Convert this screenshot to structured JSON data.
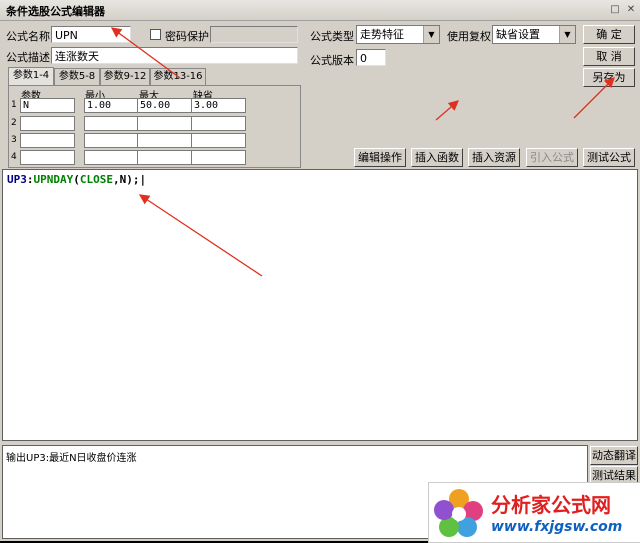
{
  "window": {
    "title": "条件选股公式编辑器",
    "restore_icon": "□",
    "close_icon": "✕"
  },
  "form": {
    "name_label": "公式名称",
    "name_value": "UPN",
    "password_label": "密码保护",
    "desc_label": "公式描述",
    "desc_value": "连涨数天",
    "type_label": "公式类型",
    "type_value": "走势特征",
    "reinstate_label": "使用复权",
    "reinstate_value": "缺省设置",
    "version_label": "公式版本",
    "version_value": "0"
  },
  "buttons": {
    "ok": "确 定",
    "cancel": "取 消",
    "save_as": "另存为",
    "edit_ops": "编辑操作",
    "insert_func": "插入函数",
    "insert_res": "插入资源",
    "import_formula": "引入公式",
    "test_formula": "测试公式",
    "dyn_translate": "动态翻译",
    "test_result": "测试结果"
  },
  "tabs": [
    "参数1-4",
    "参数5-8",
    "参数9-12",
    "参数13-16"
  ],
  "params": {
    "headers": [
      "参数",
      "最小",
      "最大",
      "缺省"
    ],
    "rows": [
      {
        "n": "1",
        "name": "N",
        "min": "1.00",
        "max": "50.00",
        "def": "3.00"
      },
      {
        "n": "2",
        "name": "",
        "min": "",
        "max": "",
        "def": ""
      },
      {
        "n": "3",
        "name": "",
        "min": "",
        "max": "",
        "def": ""
      },
      {
        "n": "4",
        "name": "",
        "min": "",
        "max": "",
        "def": ""
      }
    ]
  },
  "editor": {
    "code_var": "UP3",
    "code_colon": ":",
    "code_func": "UPNDAY",
    "code_open": "(",
    "code_arg": "CLOSE",
    "code_rest": ",N);"
  },
  "output": {
    "text": "输出UP3:最近N日收盘价连涨"
  },
  "logo": {
    "text_cn": "分析家公式网",
    "url": "www.fxjgsw.com"
  },
  "colors": {
    "annotation_arrow": "#e03020",
    "code_var": "#000080",
    "code_func": "#008000"
  }
}
